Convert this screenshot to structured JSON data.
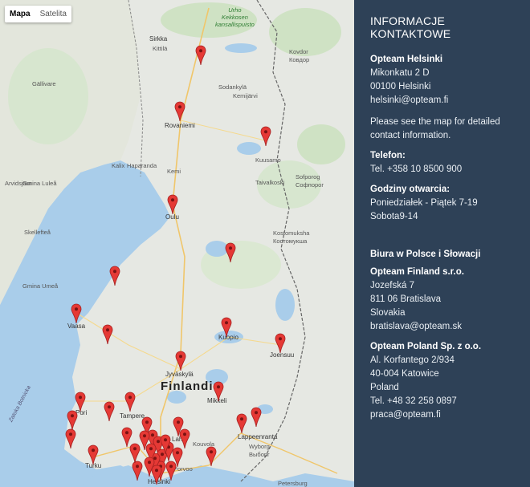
{
  "map": {
    "type_buttons": [
      "Mapa",
      "Satelita"
    ],
    "country_label": "Finlandia",
    "park_label": [
      "Urho",
      "Kekkosen",
      "kansallispuisto"
    ],
    "sea_label": "Zatoka Botnicka",
    "labels": [
      {
        "text": "Sirkka",
        "cls": "city"
      },
      {
        "text": "Kittilä",
        "cls": ""
      },
      {
        "text": "Sodankylä",
        "cls": ""
      },
      {
        "text": "Kovdor",
        "cls": ""
      },
      {
        "text": "Ковдор",
        "cls": ""
      },
      {
        "text": "Gällivare",
        "cls": ""
      },
      {
        "text": "Rovaniemi",
        "cls": "city"
      },
      {
        "text": "Kemijärvi",
        "cls": ""
      },
      {
        "text": "Kuusamo",
        "cls": ""
      },
      {
        "text": "Kalix",
        "cls": ""
      },
      {
        "text": "Haparanda",
        "cls": ""
      },
      {
        "text": "Kemi",
        "cls": ""
      },
      {
        "text": "Gmina Luleå",
        "cls": ""
      },
      {
        "text": "Arvidsjaur",
        "cls": ""
      },
      {
        "text": "Taivalkoski",
        "cls": ""
      },
      {
        "text": "Sofporog",
        "cls": ""
      },
      {
        "text": "Софпорог",
        "cls": ""
      },
      {
        "text": "Oulu",
        "cls": "city"
      },
      {
        "text": "Skellefteå",
        "cls": ""
      },
      {
        "text": "Kostomuksha",
        "cls": ""
      },
      {
        "text": "Костомукша",
        "cls": ""
      },
      {
        "text": "Gmina Umeå",
        "cls": ""
      },
      {
        "text": "Vaasa",
        "cls": "city"
      },
      {
        "text": "Kuopio",
        "cls": "city"
      },
      {
        "text": "Joensuu",
        "cls": "city"
      },
      {
        "text": "Jyväskylä",
        "cls": "city"
      },
      {
        "text": "Mikkeli",
        "cls": "city"
      },
      {
        "text": "Pori",
        "cls": "city"
      },
      {
        "text": "Tampere",
        "cls": "city"
      },
      {
        "text": "Lahti",
        "cls": "city"
      },
      {
        "text": "Lappeenranta",
        "cls": "city"
      },
      {
        "text": "Kouvola",
        "cls": ""
      },
      {
        "text": "Wyborg",
        "cls": ""
      },
      {
        "text": "Выборг",
        "cls": ""
      },
      {
        "text": "Turku",
        "cls": "city"
      },
      {
        "text": "Porvoo",
        "cls": ""
      },
      {
        "text": "Helsinki",
        "cls": "city"
      },
      {
        "text": "Petersburg",
        "cls": ""
      }
    ],
    "pin_color": "#e53935",
    "pin_count": 40
  },
  "contact": {
    "heading": "INFORMACJE KONTAKTOWE",
    "helsinki": {
      "name": "Opteam Helsinki",
      "street": "Mikonkatu 2 D",
      "city": "00100 Helsinki",
      "email": "helsinki@opteam.fi",
      "note": "Please see the map for detailed contact information."
    },
    "phone": {
      "label": "Telefon:",
      "value": "Tel. +358 10 8500 900"
    },
    "hours": {
      "label": "Godziny otwarcia:",
      "weekdays": "Poniedziałek - Piątek 7-19",
      "saturday": "Sobota9-14"
    },
    "offices_title": "Biura w Polsce i Słowacji",
    "finland_sro": {
      "name": "Opteam Finland s.r.o.",
      "street": "Jozefská 7",
      "city": "811 06 Bratislava",
      "country": "Slovakia",
      "email": "bratislava@opteam.sk"
    },
    "poland": {
      "name": "Opteam Poland Sp. z o.o.",
      "street": "Al. Korfantego 2/934",
      "city": "40-004 Katowice",
      "country": "Poland",
      "phone": "Tel. +48 32 258 0897",
      "email": "praca@opteam.fi"
    }
  }
}
